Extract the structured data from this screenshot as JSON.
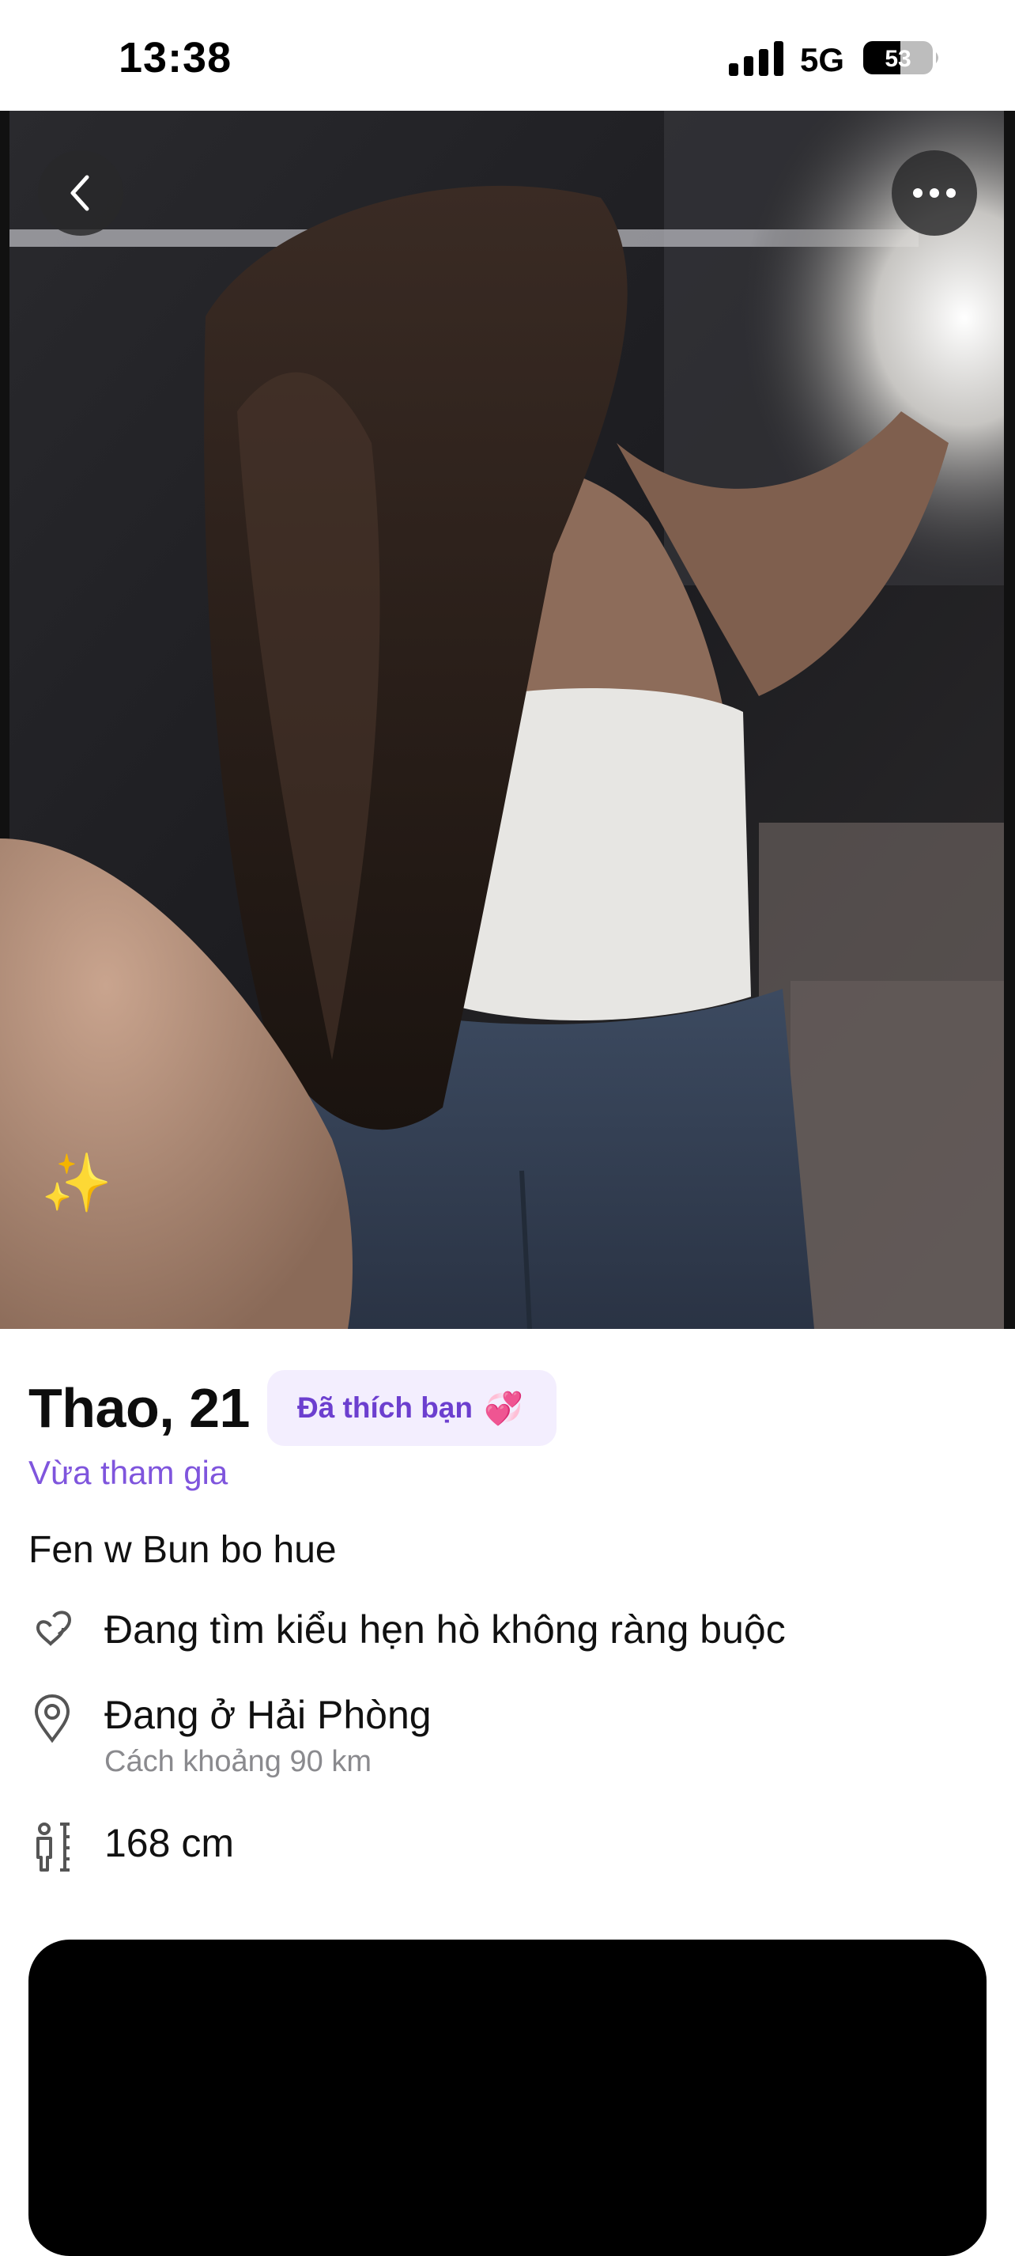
{
  "status_bar": {
    "time": "13:38",
    "network": "5G",
    "battery": "53"
  },
  "photo": {
    "sparkle_emoji": "✨"
  },
  "profile": {
    "name_age": "Thao, 21",
    "liked_badge": "Đã thích bạn",
    "liked_emoji": "💞",
    "joined_status": "Vừa tham gia",
    "bio": "Fen w Bun bo hue",
    "looking_for": "Đang tìm kiểu hẹn hò không ràng buộc",
    "location": "Đang ở Hải Phòng",
    "distance": "Cách  khoảng 90 km",
    "height": "168 cm"
  },
  "colors": {
    "accent_purple": "#7f55dd",
    "badge_bg": "#f3eefe",
    "badge_text": "#6c3fcf"
  },
  "icons": [
    "back-chevron-icon",
    "more-dots-icon",
    "hearts-icon",
    "location-pin-icon",
    "height-icon",
    "signal-icon",
    "battery-icon"
  ]
}
